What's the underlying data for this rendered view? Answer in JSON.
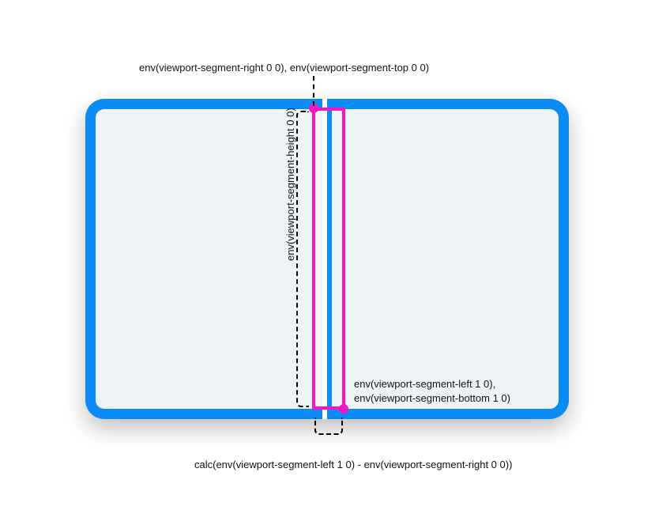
{
  "labels": {
    "top": "env(viewport-segment-right 0 0), env(viewport-segment-top 0 0)",
    "height": "env(viewport-segment-height 0 0)",
    "right_line1": "env(viewport-segment-left 1 0),",
    "right_line2": "env(viewport-segment-bottom 1 0)",
    "bottom": "calc(env(viewport-segment-left 1 0) - env(viewport-segment-right 0 0))"
  },
  "colors": {
    "device_border": "#0b8bf4",
    "panel_fill": "#eef4f6",
    "highlight": "#f316c2"
  }
}
